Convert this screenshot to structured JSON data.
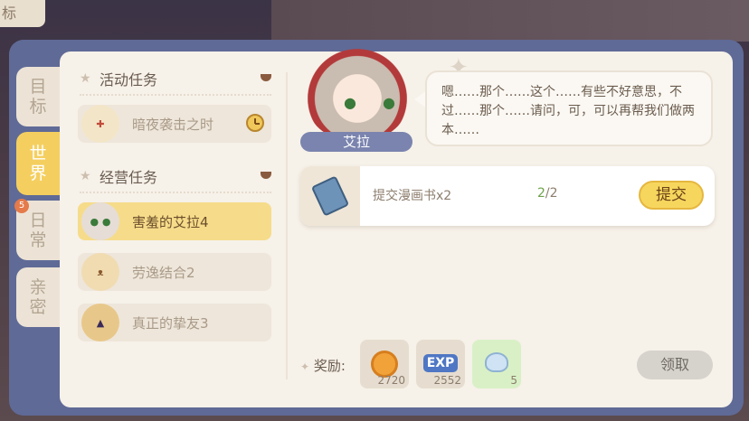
{
  "background": {
    "corner_label": "标"
  },
  "tabs": [
    {
      "label": "目标",
      "active": false
    },
    {
      "label": "世界",
      "active": true
    },
    {
      "label": "日常",
      "active": false,
      "badge": "5"
    },
    {
      "label": "亲密",
      "active": false
    }
  ],
  "sections": {
    "event": {
      "title": "活动任务",
      "quests": [
        {
          "label": "暗夜袭击之时",
          "active": false,
          "avatar": "girl-nurse"
        }
      ]
    },
    "business": {
      "title": "经营任务",
      "quests": [
        {
          "label": "害羞的艾拉4",
          "active": true,
          "avatar": "ayla"
        },
        {
          "label": "劳逸结合2",
          "active": false,
          "avatar": "bear-girl"
        },
        {
          "label": "真正的挚友3",
          "active": false,
          "avatar": "witch"
        }
      ]
    }
  },
  "npc": {
    "name": "艾拉"
  },
  "dialog": {
    "text": "嗯……那个……这个……有些不好意思，不过……那个……请问，可，可以再帮我们做两本……"
  },
  "task": {
    "label": "提交漫画书x2",
    "progress_current": "2",
    "progress_total": "/2",
    "submit_label": "提交"
  },
  "rewards": {
    "label": "奖励:",
    "items": [
      {
        "icon": "coin-icon",
        "qty": "2720"
      },
      {
        "icon": "exp-icon",
        "text": "EXP",
        "qty": "2552"
      },
      {
        "icon": "crystal-icon",
        "qty": "5"
      }
    ]
  },
  "claim_label": "领取",
  "colors": {
    "frame": "#5f6a96",
    "active_tab": "#f4cf60",
    "active_quest": "#f6dc8a",
    "submit": "#f7d65e"
  }
}
